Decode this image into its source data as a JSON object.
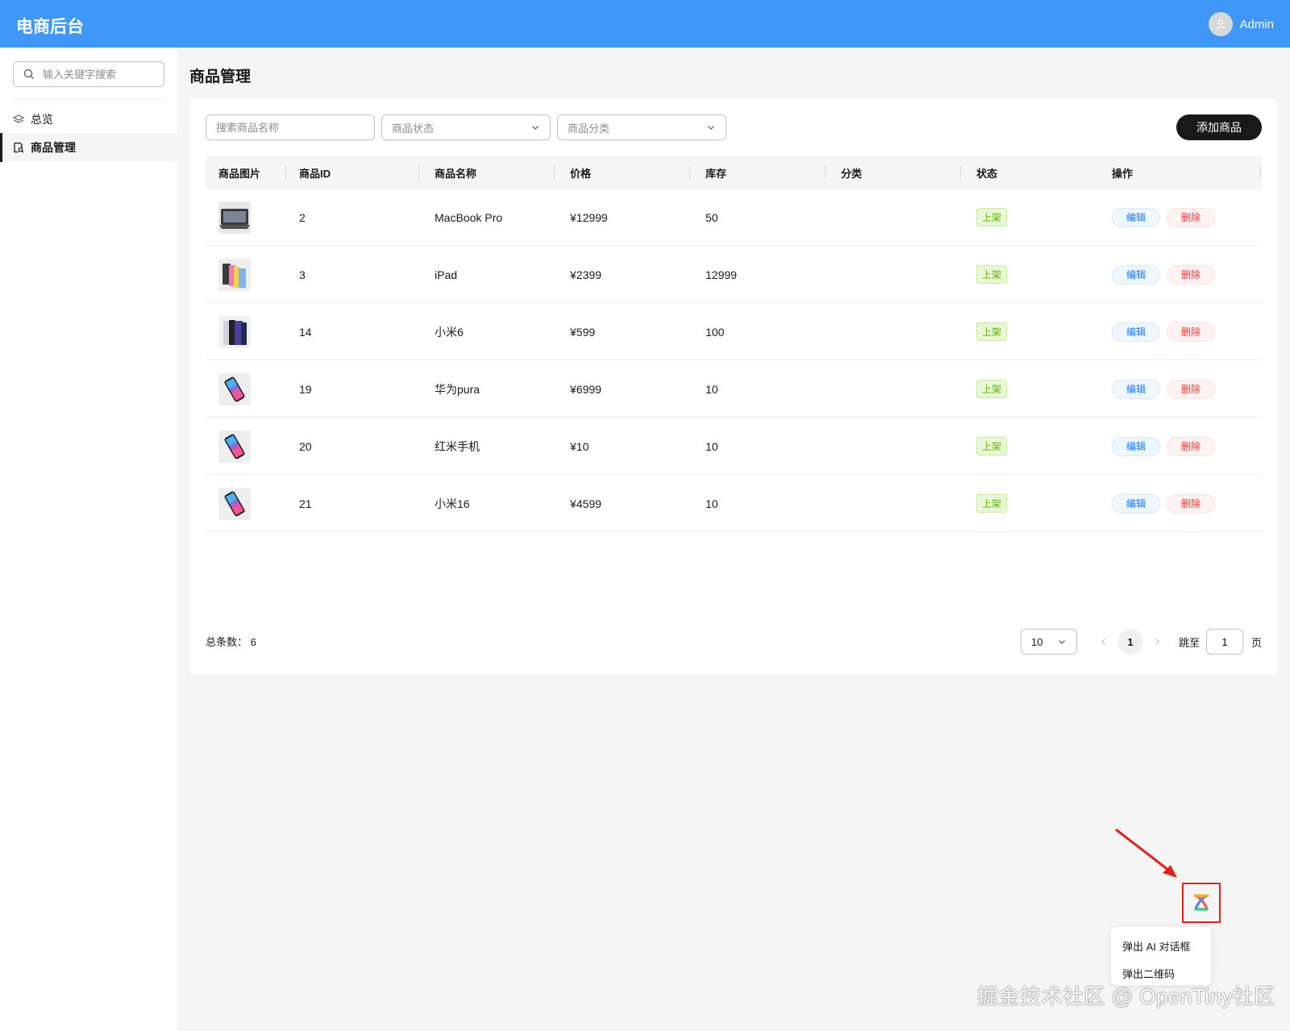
{
  "header": {
    "brand": "电商后台",
    "user_name": "Admin"
  },
  "sidebar": {
    "search_placeholder": "输入关键字搜索",
    "items": [
      {
        "label": "总览",
        "icon": "layers-icon",
        "active": false
      },
      {
        "label": "商品管理",
        "icon": "document-search-icon",
        "active": true
      }
    ]
  },
  "main": {
    "title": "商品管理",
    "filters": {
      "name_placeholder": "搜索商品名称",
      "status_placeholder": "商品状态",
      "category_placeholder": "商品分类"
    },
    "add_button": "添加商品",
    "columns": [
      "商品图片",
      "商品ID",
      "商品名称",
      "价格",
      "库存",
      "分类",
      "状态",
      "操作"
    ],
    "rows": [
      {
        "id": "2",
        "name": "MacBook Pro",
        "price": "¥12999",
        "stock": "50",
        "category": "",
        "status": "上架",
        "image": "laptop"
      },
      {
        "id": "3",
        "name": "iPad",
        "price": "¥2399",
        "stock": "12999",
        "category": "",
        "status": "上架",
        "image": "tablet"
      },
      {
        "id": "14",
        "name": "小米6",
        "price": "¥599",
        "stock": "100",
        "category": "",
        "status": "上架",
        "image": "phone-dark"
      },
      {
        "id": "19",
        "name": "华为pura",
        "price": "¥6999",
        "stock": "10",
        "category": "",
        "status": "上架",
        "image": "phone-color"
      },
      {
        "id": "20",
        "name": "红米手机",
        "price": "¥10",
        "stock": "10",
        "category": "",
        "status": "上架",
        "image": "phone-color"
      },
      {
        "id": "21",
        "name": "小米16",
        "price": "¥4599",
        "stock": "10",
        "category": "",
        "status": "上架",
        "image": "phone-color"
      }
    ],
    "actions": {
      "edit": "编辑",
      "delete": "删除"
    },
    "pagination": {
      "total_label": "总条数：",
      "total": "6",
      "page_size": "10",
      "current_page": "1",
      "jump_label": "跳至",
      "jump_value": "1",
      "page_suffix": "页"
    }
  },
  "floating": {
    "icon": "tiny-robot-icon",
    "menu": [
      "弹出 AI 对话框",
      "弹出二维码"
    ]
  },
  "watermark": "掘金技术社区 @ OpenTiny社区",
  "colors": {
    "header": "#3f97f7",
    "primary": "#191919",
    "edit": "#1476ff",
    "delete": "#f23030",
    "status": "#5cb300",
    "highlight": "#e0211c"
  }
}
